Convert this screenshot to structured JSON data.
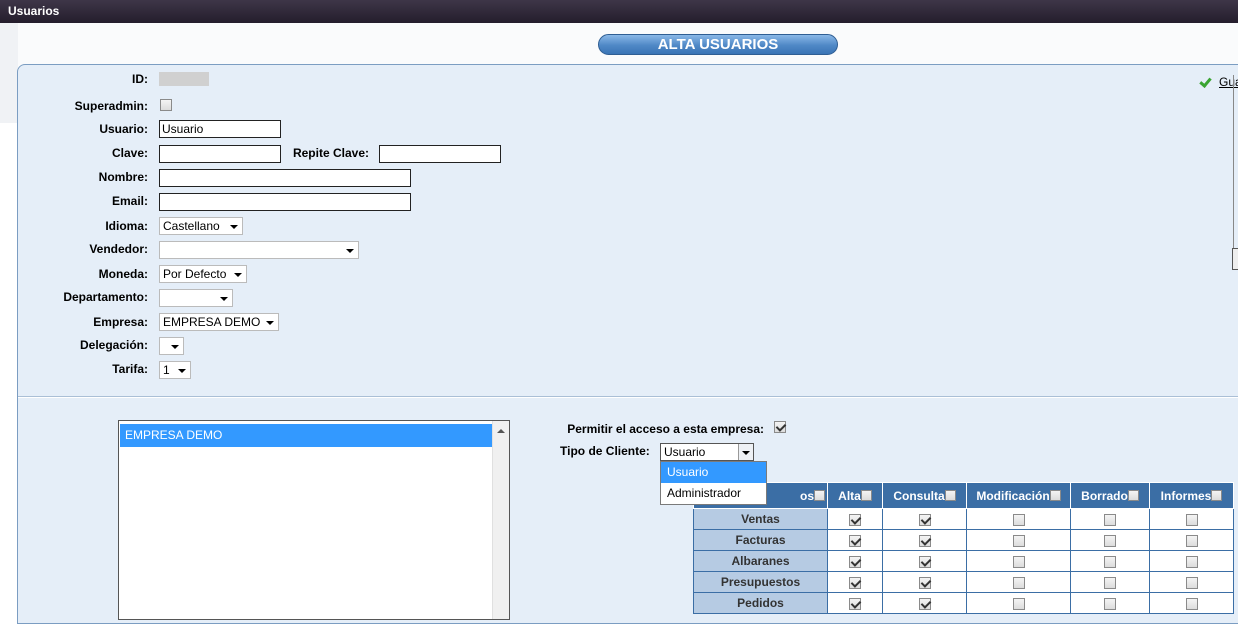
{
  "window": {
    "title": "Usuarios"
  },
  "page": {
    "title": "ALTA USUARIOS",
    "save_label": "Gua"
  },
  "form": {
    "id_label": "ID:",
    "superadmin_label": "Superadmin:",
    "usuario_label": "Usuario:",
    "usuario_value": "Usuario",
    "clave_label": "Clave:",
    "repite_clave_label": "Repite Clave:",
    "nombre_label": "Nombre:",
    "email_label": "Email:",
    "idioma_label": "Idioma:",
    "idioma_value": "Castellano",
    "vendedor_label": "Vendedor:",
    "vendedor_value": "",
    "moneda_label": "Moneda:",
    "moneda_value": "Por Defecto",
    "departamento_label": "Departamento:",
    "departamento_value": "",
    "empresa_label": "Empresa:",
    "empresa_value": "EMPRESA DEMO",
    "delegacion_label": "Delegación:",
    "delegacion_value": "",
    "tarifa_label": "Tarifa:",
    "tarifa_value": "1"
  },
  "empresas_list": {
    "items": [
      "EMPRESA DEMO"
    ]
  },
  "access": {
    "permitir_label": "Permitir el acceso a esta empresa:",
    "permitir_checked": true,
    "tipo_cliente_label": "Tipo de Cliente:",
    "tipo_cliente_value": "Usuario",
    "tipo_cliente_options": [
      "Usuario",
      "Administrador"
    ]
  },
  "permissions": {
    "headers": [
      "os",
      "Alta",
      "Consulta",
      "Modificación",
      "Borrado",
      "Informes"
    ],
    "rows": [
      {
        "name": "Ventas",
        "values": [
          true,
          true,
          false,
          false,
          false
        ]
      },
      {
        "name": "Facturas",
        "values": [
          true,
          true,
          false,
          false,
          false
        ]
      },
      {
        "name": "Albaranes",
        "values": [
          true,
          true,
          false,
          false,
          false
        ]
      },
      {
        "name": "Presupuestos",
        "values": [
          true,
          true,
          false,
          false,
          false
        ]
      },
      {
        "name": "Pedidos",
        "values": [
          true,
          true,
          false,
          false,
          false
        ]
      }
    ]
  },
  "colors": {
    "accent": "#3b6ea5",
    "panel_bg": "#e5eef8",
    "selection": "#3399ff"
  }
}
